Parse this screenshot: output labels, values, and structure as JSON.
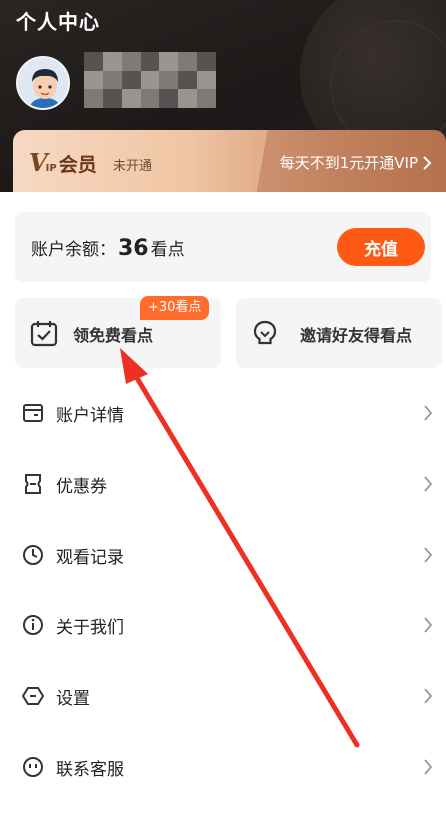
{
  "header": {
    "title": "个人中心"
  },
  "vip": {
    "logo_v": "V",
    "logo_ip": "IP",
    "logo_text": "会员",
    "status": "未开通",
    "cta": "每天不到1元开通VIP"
  },
  "balance": {
    "label": "账户余额：",
    "amount": "36",
    "unit": "看点",
    "recharge_label": "充值"
  },
  "tasks": {
    "free_points": {
      "label": "领免费看点",
      "badge": "+30看点",
      "icon": "calendar-check-icon"
    },
    "invite": {
      "label": "邀请好友得看点",
      "icon": "lightbulb-icon"
    }
  },
  "menu": {
    "items": [
      {
        "label": "账户详情",
        "icon": "wallet-icon"
      },
      {
        "label": "优惠券",
        "icon": "coupon-icon"
      },
      {
        "label": "观看记录",
        "icon": "clock-icon"
      },
      {
        "label": "关于我们",
        "icon": "info-icon"
      },
      {
        "label": "设置",
        "icon": "settings-hexagon-icon"
      },
      {
        "label": "联系客服",
        "icon": "smile-service-icon"
      }
    ]
  },
  "colors": {
    "accent": "#ff5a14",
    "badge": "#ff6c2c",
    "header_bg": "#1f1b19",
    "annotation_arrow": "#ee2f24"
  }
}
